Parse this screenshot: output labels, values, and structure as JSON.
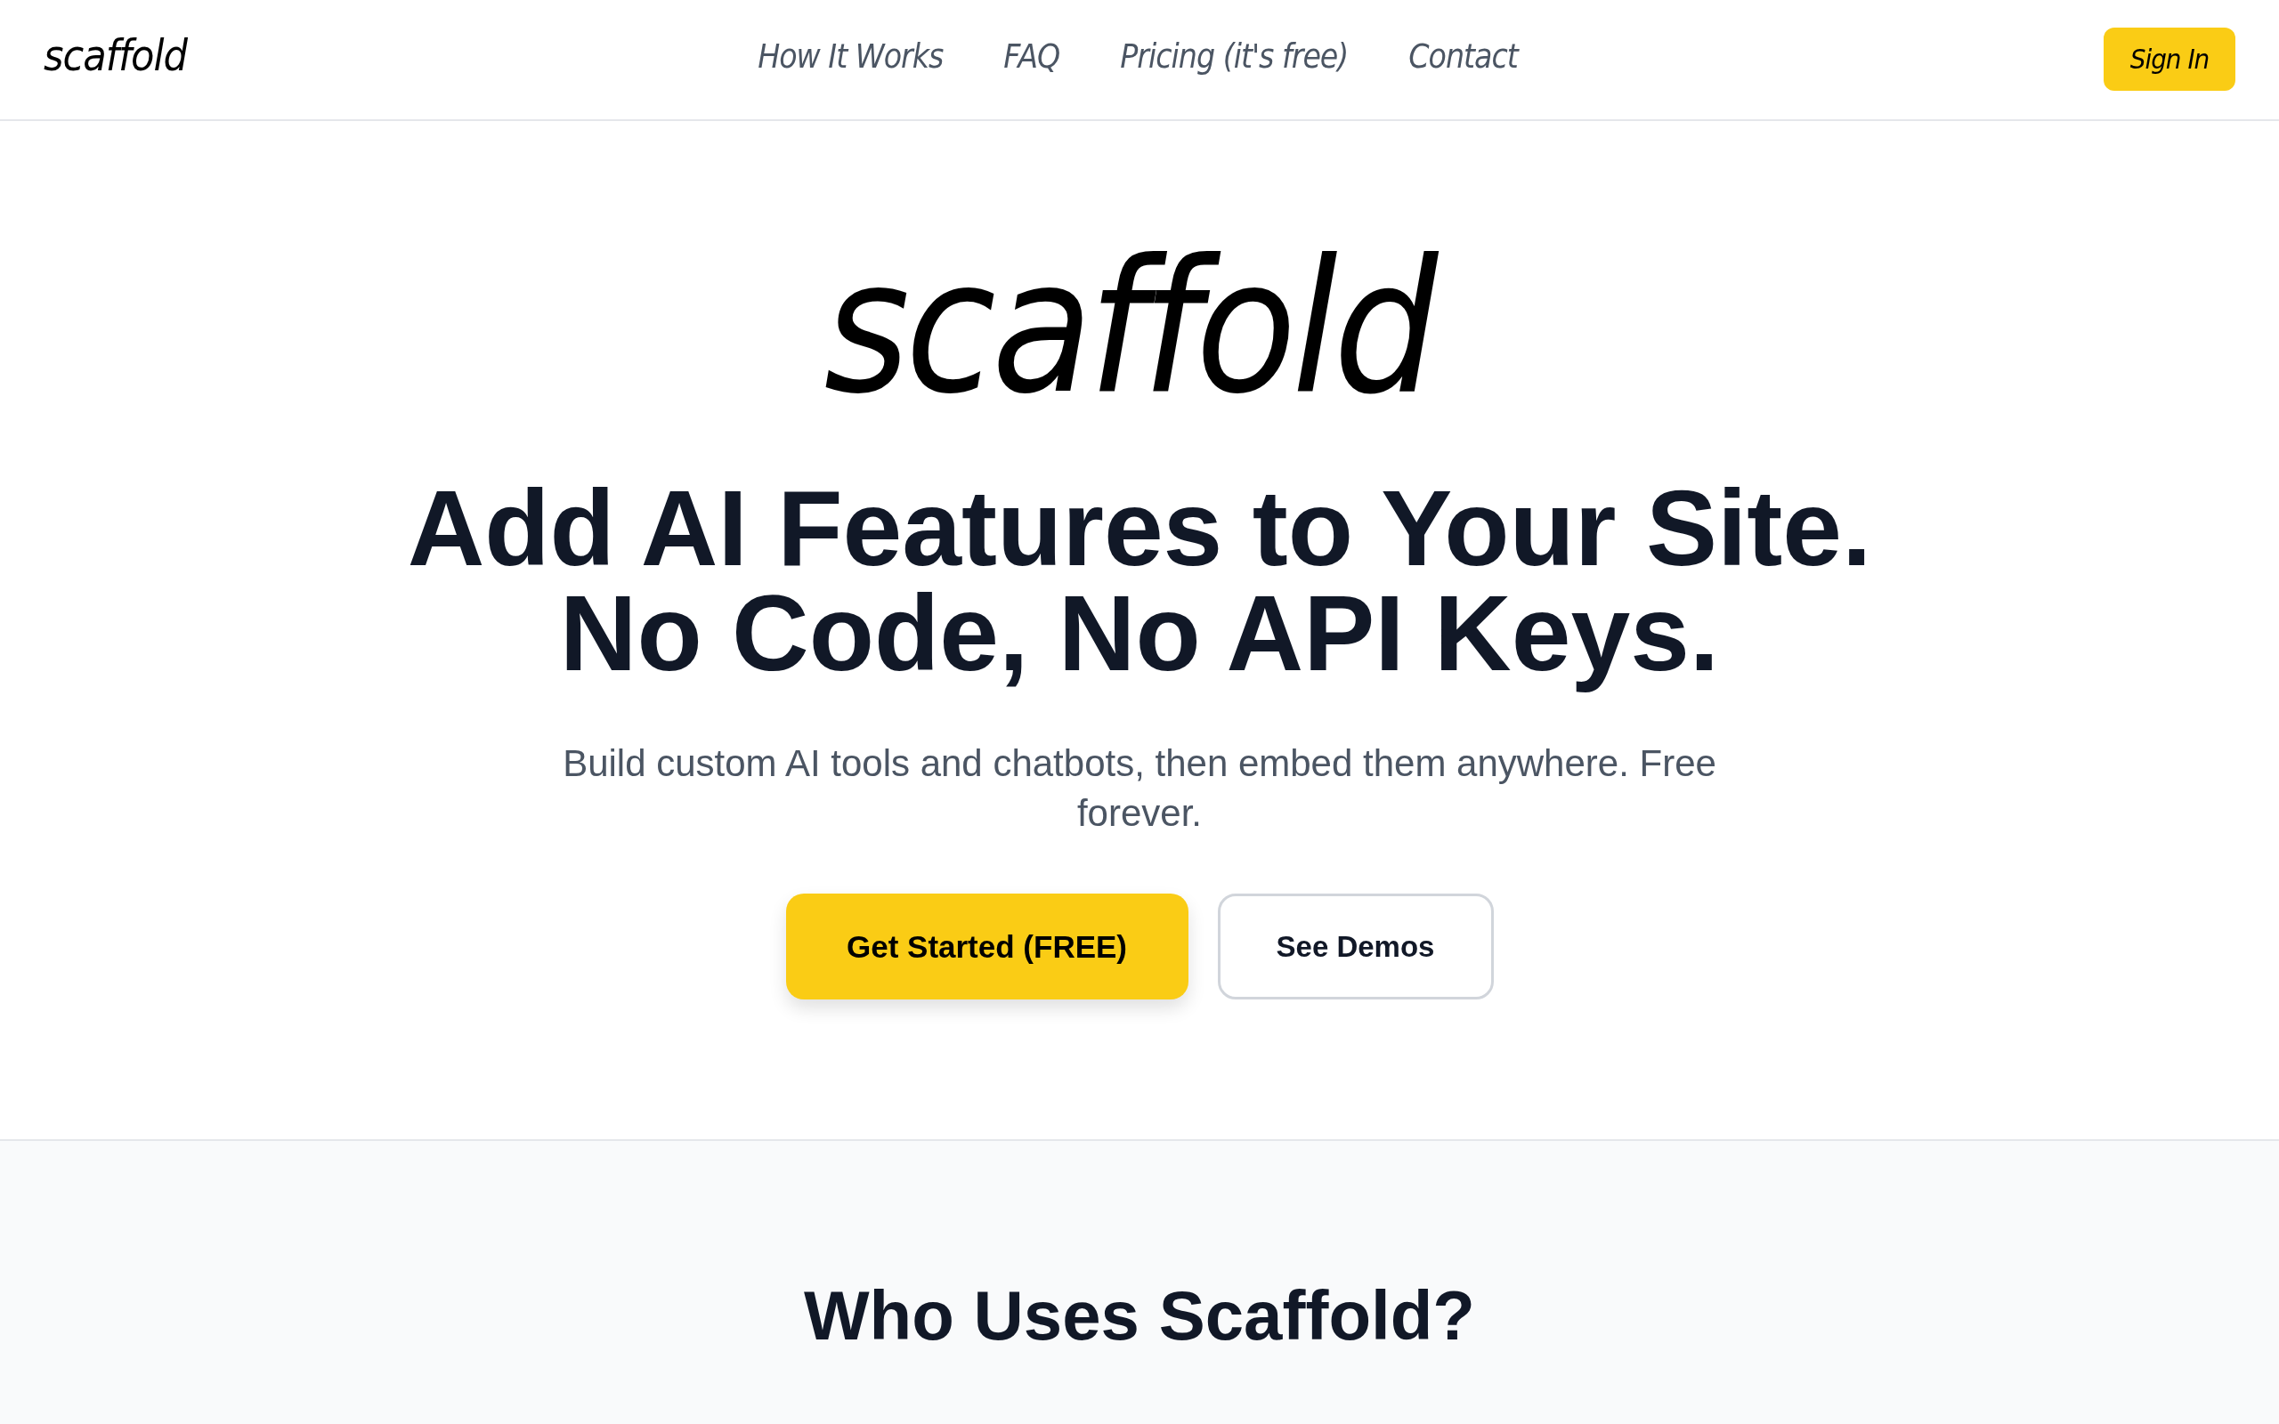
{
  "nav": {
    "logo": "scaffold",
    "links": [
      "How It Works",
      "FAQ",
      "Pricing (it's free)",
      "Contact"
    ],
    "sign_in": "Sign In"
  },
  "hero": {
    "logo": "scaffold",
    "headline": [
      "Add AI Features to Your Site.",
      "No Code, No API Keys."
    ],
    "subtitle": "Build custom AI tools and chatbots, then embed them anywhere. Free forever.",
    "buttons": [
      {
        "label": "Get Started (FREE)",
        "kind": "primary"
      },
      {
        "label": "See Demos",
        "kind": "secondary"
      }
    ]
  },
  "users_section": {
    "title": "Who Uses Scaffold?"
  }
}
